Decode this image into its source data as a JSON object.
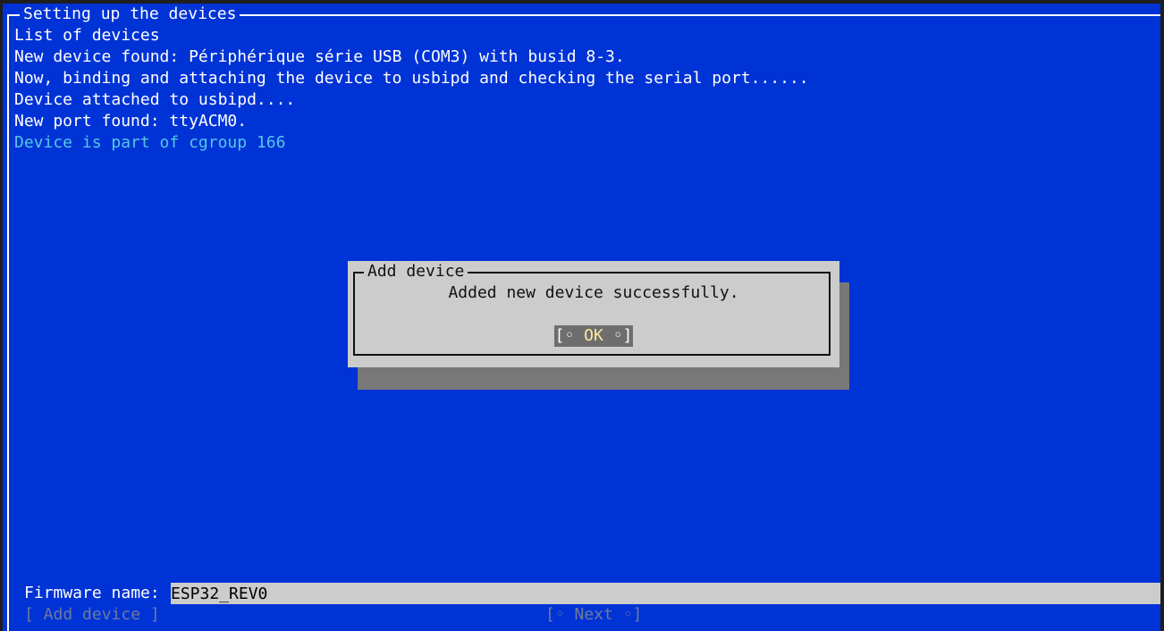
{
  "window": {
    "title": "Setting up the devices"
  },
  "log": {
    "lines": [
      "List of devices",
      "New device found: Périphérique série USB (COM3) with busid 8-3.",
      "Now, binding and attaching the device to usbipd and checking the serial port......",
      "Device attached to usbipd....",
      "New port found: ttyACM0."
    ],
    "highlight_line": "Device is part of cgroup 166"
  },
  "dialog": {
    "title": "Add device",
    "message": "Added new device successfully.",
    "ok_button": {
      "open": "[◦",
      "label": "OK",
      "close": "◦]"
    }
  },
  "form": {
    "firmware_label": "Firmware name:",
    "firmware_value": "ESP32_REV0",
    "add_device_button": "[ Add device ]",
    "next_button": "[◦ Next ◦]"
  },
  "colors": {
    "background": "#0033d6",
    "highlight_text": "#55c8e6",
    "dialog_bg": "#cccccc",
    "disabled_text": "#6e7a9c"
  }
}
